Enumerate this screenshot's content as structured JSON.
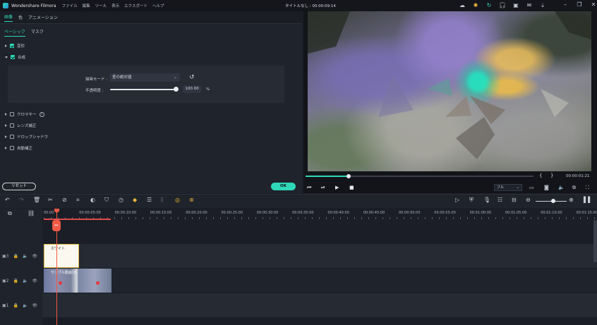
{
  "app": {
    "name": "Wondershare Filmora",
    "menu": [
      "ファイル",
      "編集",
      "ツール",
      "表示",
      "エクスポート",
      "ヘルプ"
    ],
    "project_title": "タイトルなし : 00:00:09:14"
  },
  "panel": {
    "tabs": [
      "画像",
      "色",
      "アニメーション"
    ],
    "subtabs": [
      "ベーシック",
      "マスク"
    ],
    "sections": {
      "transform": "変形",
      "composite": "合成",
      "chroma": "クロマキー",
      "lens": "レンズ補正",
      "shadow": "ドロップシャドウ",
      "auto": "自動補正"
    },
    "blend_label": "描画モード :",
    "blend_value": "差の絶対値",
    "opacity_label": "不透明度 :",
    "opacity_value": "100.00",
    "opacity_unit": "%",
    "opacity_level": 1.0,
    "reset_label": "リセット",
    "ok_label": "OK"
  },
  "preview": {
    "time": "00:00:01:21",
    "progress": 0.19,
    "quality": "フル"
  },
  "ruler": {
    "labels": [
      "00:00",
      "00:00:05:00",
      "00:00:10:00",
      "00:00:15:00",
      "00:00:20:00",
      "00:00:25:00",
      "00:00:30:00",
      "00:00:35:00",
      "00:00:40:00",
      "00:00:45:00",
      "00:00:50:00",
      "00:00:55:00",
      "00:01:00:00",
      "00:01:05:00",
      "00:01:10:00",
      "00:01:15:00"
    ]
  },
  "tracks": [
    {
      "num": "3"
    },
    {
      "num": "2"
    },
    {
      "num": "1"
    }
  ],
  "clips": {
    "white_label": "ホワイト",
    "video_label": "サンプル動画10"
  },
  "colors": {
    "accent": "#2fd8b8",
    "playhead": "#f05a46"
  }
}
